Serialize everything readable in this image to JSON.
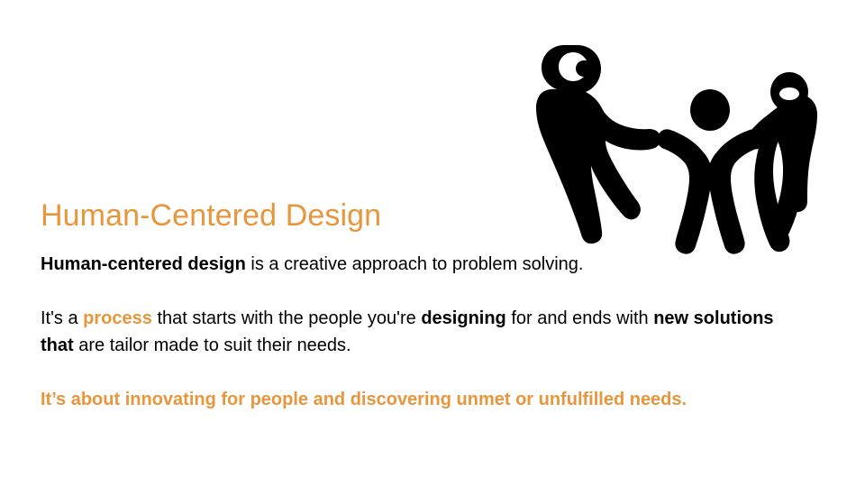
{
  "slide": {
    "title": "Human-Centered Design",
    "paragraph1": {
      "lead_bold": "Human-centered design",
      "rest": " is a creative approach to problem solving."
    },
    "paragraph2": {
      "seg1": "It's a ",
      "seg2_orange_bold": "process",
      "seg3": " that starts with the people you're ",
      "seg4_bold": "designing",
      "seg5": " for and ends with ",
      "seg6_bold": "new solutions that",
      "seg7": " are tailor made to suit their needs."
    },
    "paragraph3": "It’s about innovating for people and discovering unmet or unfulfilled needs.",
    "artwork_name": "three-people-celebrating-silhouette",
    "colors": {
      "accent": "#E8963C",
      "text": "#000000",
      "background": "#FFFFFF",
      "artwork": "#000000"
    }
  }
}
